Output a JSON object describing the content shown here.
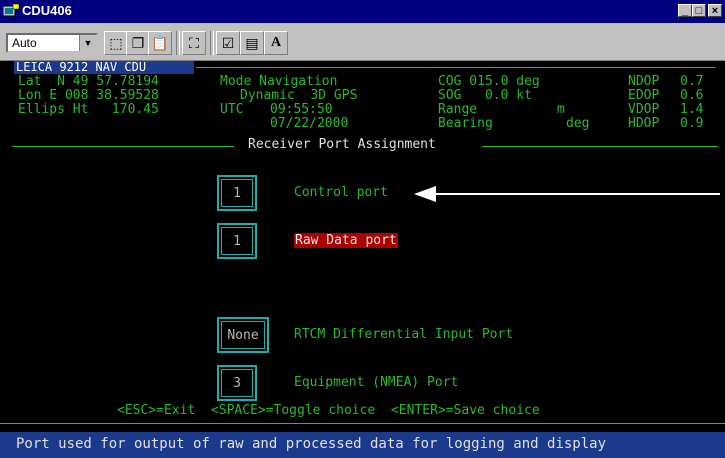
{
  "window": {
    "title": "CDU406"
  },
  "toolbar": {
    "font_size_value": "Auto"
  },
  "header": {
    "device": "LEICA 9212 NAV  CDU",
    "lat": "Lat  N 49 57.78194",
    "lon": "Lon E 008 38.59528",
    "ellips": "Ellips Ht   170.45",
    "mode": "Mode Navigation",
    "dynamic": "Dynamic  3D GPS",
    "utc_label": "UTC",
    "utc_time": "09:55:50",
    "date": "07/22/2000",
    "cog": "COG 015.0 deg",
    "sog": "SOG   0.0 kt",
    "range_label": "Range",
    "range_unit": "m",
    "bearing_label": "Bearing",
    "bearing_unit": "deg",
    "ndop_label": "NDOP",
    "ndop_value": "0.7",
    "edop_label": "EDOP",
    "edop_value": "0.6",
    "vdop_label": "VDOP",
    "vdop_value": "1.4",
    "hdop_label": "HDOP",
    "hdop_value": "0.9"
  },
  "panel": {
    "title": "Receiver Port Assignment",
    "fields": [
      {
        "value": "1",
        "label": "Control port"
      },
      {
        "value": "1",
        "label": "Raw Data port"
      },
      {
        "value": "None",
        "label": "RTCM Differential Input Port"
      },
      {
        "value": "3",
        "label": "Equipment (NMEA) Port"
      }
    ],
    "key_help": "<ESC>=Exit  <SPACE>=Toggle choice  <ENTER>=Save choice"
  },
  "status": {
    "message": "Port used for output of raw and processed data for logging and display"
  },
  "colors": {
    "title_bar": "#000080",
    "terminal_text": "#2db82d",
    "field_border": "#2aa8a8",
    "highlight": "#aa0000",
    "status_bar": "#1c3a8c"
  }
}
